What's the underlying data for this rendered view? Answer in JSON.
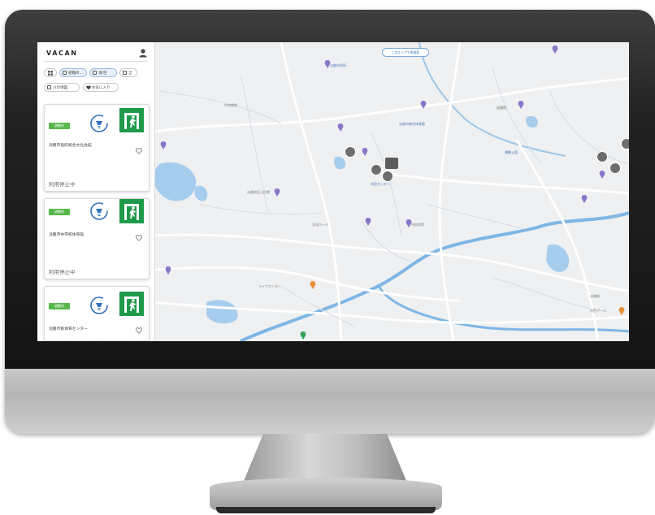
{
  "app": {
    "logo": "VACAN",
    "user_icon": "user-icon"
  },
  "filters": {
    "row1": [
      {
        "icon": "grid-icon",
        "label": ""
      },
      {
        "icon": "filter-icon",
        "label": "避難所..."
      },
      {
        "icon": "status-icon",
        "label": "満/空"
      },
      {
        "icon": "list-icon",
        "label": "全"
      }
    ],
    "row2": [
      {
        "icon": "map-icon",
        "label": "川の地図"
      },
      {
        "icon": "heart-icon",
        "label": "お気に入り"
      }
    ]
  },
  "cards": [
    {
      "badge": "避難所",
      "name": "淡路市島町総合文化会館",
      "status": "利用停止中"
    },
    {
      "badge": "避難所",
      "name": "淡路市中学校体育館",
      "status": "利用停止中"
    },
    {
      "badge": "避難所",
      "name": "淡路市民体育センター",
      "status": ""
    }
  ],
  "map": {
    "top_button": "このエリアで再検索",
    "places": [
      "淡路市役所",
      "淡路市総合体育館",
      "中央病院",
      "市民センター",
      "図書館",
      "淡路地区公民館",
      "ライフセンター",
      "運動公園",
      "文化ホール",
      "市民病院",
      "淡路駅",
      "市民プール"
    ]
  },
  "colors": {
    "accent_green": "#57b84a",
    "exit_green": "#1e9a4b",
    "bulb_blue": "#2f6fc0",
    "water": "#7eb6e6",
    "road": "#ffffff",
    "map_bg": "#eef0f2"
  }
}
